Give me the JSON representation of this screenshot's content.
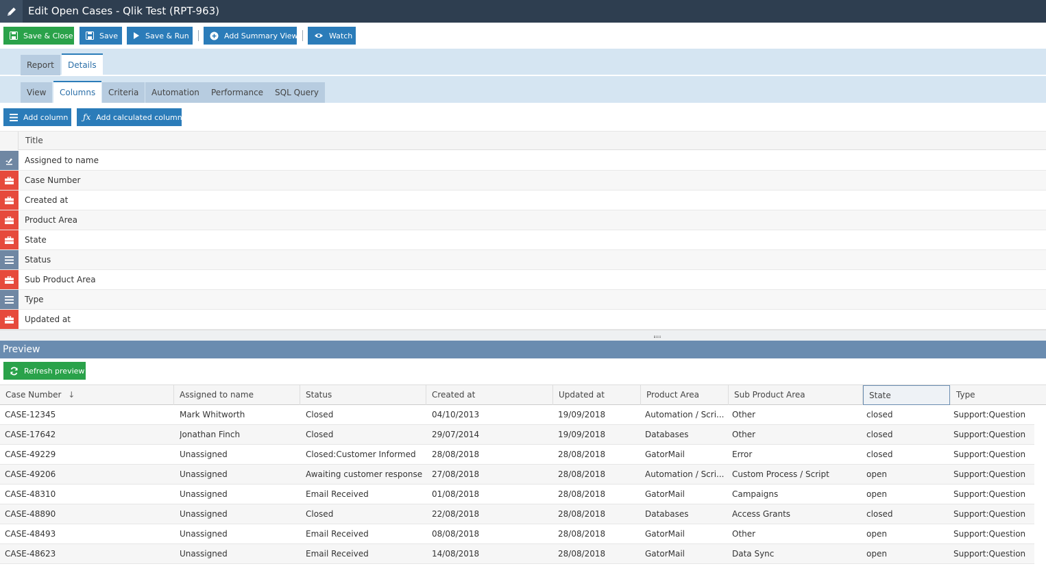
{
  "window": {
    "title": "Edit Open Cases - Qlik Test (RPT-963)"
  },
  "toolbar": {
    "save_close": "Save & Close",
    "save": "Save",
    "save_run": "Save & Run",
    "add_summary": "Add Summary View",
    "watch": "Watch"
  },
  "tabs_top": [
    "Report",
    "Details"
  ],
  "tabs_sub": [
    "View",
    "Columns",
    "Criteria",
    "Automation",
    "Performance",
    "SQL Query"
  ],
  "column_actions": {
    "add_column": "Add column",
    "add_calculated": "Add calculated column"
  },
  "columns_table": {
    "header": "Title",
    "rows": [
      {
        "label": "Assigned to name",
        "icon": "user-field-icon"
      },
      {
        "label": "Case Number",
        "icon": "briefcase-icon"
      },
      {
        "label": "Created at",
        "icon": "briefcase-icon"
      },
      {
        "label": "Product Area",
        "icon": "briefcase-icon"
      },
      {
        "label": "State",
        "icon": "briefcase-icon"
      },
      {
        "label": "Status",
        "icon": "list-icon"
      },
      {
        "label": "Sub Product Area",
        "icon": "briefcase-icon"
      },
      {
        "label": "Type",
        "icon": "list-icon"
      },
      {
        "label": "Updated at",
        "icon": "briefcase-icon"
      }
    ]
  },
  "preview": {
    "title": "Preview",
    "refresh": "Refresh preview",
    "headers": [
      "Case Number",
      "Assigned to name",
      "Status",
      "Created at",
      "Updated at",
      "Product Area",
      "Sub Product Area",
      "State",
      "Type"
    ],
    "rows": [
      [
        "CASE-12345",
        "Mark Whitworth",
        "Closed",
        "04/10/2013",
        "19/09/2018",
        "Automation / Scri...",
        "Other",
        "closed",
        "Support:Question"
      ],
      [
        "CASE-17642",
        "Jonathan Finch",
        "Closed",
        "29/07/2014",
        "19/09/2018",
        "Databases",
        "Other",
        "closed",
        "Support:Question"
      ],
      [
        "CASE-49229",
        "Unassigned",
        "Closed:Customer Informed",
        "28/08/2018",
        "28/08/2018",
        "GatorMail",
        "Error",
        "closed",
        "Support:Question"
      ],
      [
        "CASE-49206",
        "Unassigned",
        "Awaiting customer response",
        "27/08/2018",
        "28/08/2018",
        "Automation / Scri...",
        "Custom Process / Script",
        "open",
        "Support:Question"
      ],
      [
        "CASE-48310",
        "Unassigned",
        "Email Received",
        "01/08/2018",
        "28/08/2018",
        "GatorMail",
        "Campaigns",
        "open",
        "Support:Question"
      ],
      [
        "CASE-48890",
        "Unassigned",
        "Closed",
        "22/08/2018",
        "28/08/2018",
        "Databases",
        "Access Grants",
        "closed",
        "Support:Question"
      ],
      [
        "CASE-48493",
        "Unassigned",
        "Email Received",
        "08/08/2018",
        "28/08/2018",
        "GatorMail",
        "Other",
        "open",
        "Support:Question"
      ],
      [
        "CASE-48623",
        "Unassigned",
        "Email Received",
        "14/08/2018",
        "28/08/2018",
        "GatorMail",
        "Data Sync",
        "open",
        "Support:Question"
      ]
    ]
  },
  "colors": {
    "titlebar": "#2e3e50",
    "green": "#2aa24a",
    "blue": "#2b7cb9",
    "red": "#e64a3c",
    "slate": "#6f87a3",
    "preview_bar": "#6a8cb0"
  }
}
